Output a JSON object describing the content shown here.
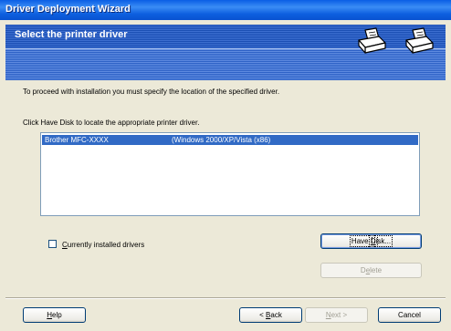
{
  "window": {
    "title": "Driver Deployment Wizard"
  },
  "header": {
    "title": "Select the printer driver",
    "icons": [
      "printer-icon",
      "printer-icon"
    ]
  },
  "instructions": {
    "location": "To proceed with installation you must specify the location of the specified driver.",
    "have_disk": "Click Have Disk to locate the appropriate printer driver."
  },
  "driver_list": {
    "items": [
      {
        "name": "Brother  MFC-XXXX",
        "platform": "(Windows 2000/XP/Vista (x86)"
      }
    ]
  },
  "checkbox": {
    "label_underline": "C",
    "label_rest": "urrently installed drivers",
    "checked": false
  },
  "buttons": {
    "have_disk": {
      "pre": "Have ",
      "ul": "D",
      "post": "isk..."
    },
    "delete": {
      "pre": "D",
      "ul": "e",
      "post": "lete"
    },
    "help": {
      "pre": "",
      "ul": "H",
      "post": "elp"
    },
    "back": {
      "pre": "< ",
      "ul": "B",
      "post": "ack"
    },
    "next": {
      "pre": "",
      "ul": "N",
      "post": "ext >"
    },
    "cancel": {
      "label": "Cancel"
    }
  },
  "colors": {
    "titlebar": "#0a5ee5",
    "selection": "#316ac5",
    "face": "#ece9d8"
  }
}
